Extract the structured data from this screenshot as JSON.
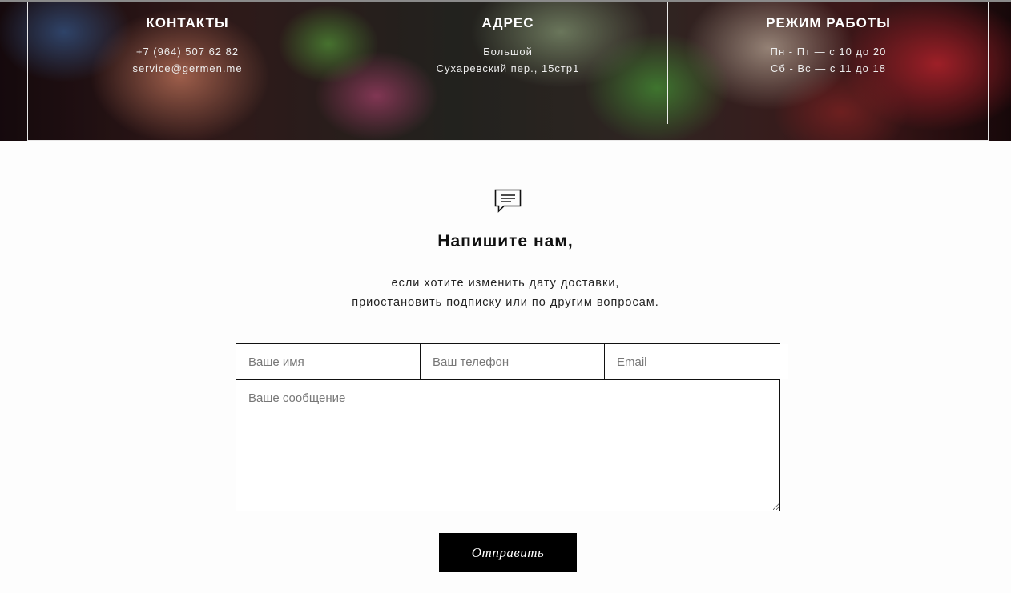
{
  "info_band": {
    "columns": [
      {
        "title": "КОНТАКТЫ",
        "lines": [
          "+7 (964) 507 62 82",
          "service@germen.me"
        ]
      },
      {
        "title": "АДРЕС",
        "lines": [
          "Большой",
          "Сухаревский пер., 15стр1"
        ]
      },
      {
        "title": "РЕЖИМ РАБОТЫ",
        "lines": [
          "Пн - Пт — с 10 до 20",
          "Сб - Вс — с 11 до 18"
        ]
      }
    ]
  },
  "contact_form": {
    "icon": "message-icon",
    "title": "Напишите нам,",
    "subtitle_lines": [
      "если хотите изменить дату доставки,",
      "приостановить подписку или по другим вопросам."
    ],
    "fields": {
      "name_placeholder": "Ваше имя",
      "phone_placeholder": "Ваш телефон",
      "email_placeholder": "Email",
      "message_placeholder": "Ваше сообщение"
    },
    "submit_label": "Отправить"
  }
}
